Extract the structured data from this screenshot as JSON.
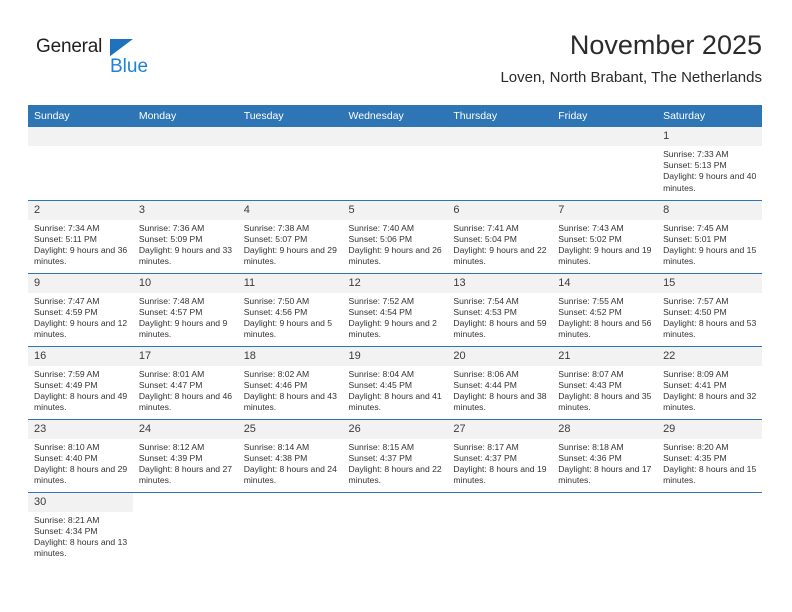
{
  "logo": {
    "word_one": "General",
    "word_two": "Blue",
    "icon": "triangle-flag-icon",
    "color_primary": "#1f73bd",
    "color_secondary": "#1f82d6"
  },
  "header": {
    "title": "November 2025",
    "subtitle": "Loven, North Brabant, The Netherlands"
  },
  "theme": {
    "header_blue": "#2e75b6",
    "daynum_gray": "#f2f2f2",
    "text": "#333333"
  },
  "calendar": {
    "weekdays": [
      "Sunday",
      "Monday",
      "Tuesday",
      "Wednesday",
      "Thursday",
      "Friday",
      "Saturday"
    ],
    "labels": {
      "sunrise": "Sunrise:",
      "sunset": "Sunset:",
      "daylight": "Daylight:"
    },
    "weeks": [
      [
        {
          "day": "",
          "empty": true
        },
        {
          "day": "",
          "empty": true
        },
        {
          "day": "",
          "empty": true
        },
        {
          "day": "",
          "empty": true
        },
        {
          "day": "",
          "empty": true
        },
        {
          "day": "",
          "empty": true
        },
        {
          "day": "1",
          "sunrise": "Sunrise: 7:33 AM",
          "sunset": "Sunset: 5:13 PM",
          "daylight": "Daylight: 9 hours and 40 minutes."
        }
      ],
      [
        {
          "day": "2",
          "sunrise": "Sunrise: 7:34 AM",
          "sunset": "Sunset: 5:11 PM",
          "daylight": "Daylight: 9 hours and 36 minutes."
        },
        {
          "day": "3",
          "sunrise": "Sunrise: 7:36 AM",
          "sunset": "Sunset: 5:09 PM",
          "daylight": "Daylight: 9 hours and 33 minutes."
        },
        {
          "day": "4",
          "sunrise": "Sunrise: 7:38 AM",
          "sunset": "Sunset: 5:07 PM",
          "daylight": "Daylight: 9 hours and 29 minutes."
        },
        {
          "day": "5",
          "sunrise": "Sunrise: 7:40 AM",
          "sunset": "Sunset: 5:06 PM",
          "daylight": "Daylight: 9 hours and 26 minutes."
        },
        {
          "day": "6",
          "sunrise": "Sunrise: 7:41 AM",
          "sunset": "Sunset: 5:04 PM",
          "daylight": "Daylight: 9 hours and 22 minutes."
        },
        {
          "day": "7",
          "sunrise": "Sunrise: 7:43 AM",
          "sunset": "Sunset: 5:02 PM",
          "daylight": "Daylight: 9 hours and 19 minutes."
        },
        {
          "day": "8",
          "sunrise": "Sunrise: 7:45 AM",
          "sunset": "Sunset: 5:01 PM",
          "daylight": "Daylight: 9 hours and 15 minutes."
        }
      ],
      [
        {
          "day": "9",
          "sunrise": "Sunrise: 7:47 AM",
          "sunset": "Sunset: 4:59 PM",
          "daylight": "Daylight: 9 hours and 12 minutes."
        },
        {
          "day": "10",
          "sunrise": "Sunrise: 7:48 AM",
          "sunset": "Sunset: 4:57 PM",
          "daylight": "Daylight: 9 hours and 9 minutes."
        },
        {
          "day": "11",
          "sunrise": "Sunrise: 7:50 AM",
          "sunset": "Sunset: 4:56 PM",
          "daylight": "Daylight: 9 hours and 5 minutes."
        },
        {
          "day": "12",
          "sunrise": "Sunrise: 7:52 AM",
          "sunset": "Sunset: 4:54 PM",
          "daylight": "Daylight: 9 hours and 2 minutes."
        },
        {
          "day": "13",
          "sunrise": "Sunrise: 7:54 AM",
          "sunset": "Sunset: 4:53 PM",
          "daylight": "Daylight: 8 hours and 59 minutes."
        },
        {
          "day": "14",
          "sunrise": "Sunrise: 7:55 AM",
          "sunset": "Sunset: 4:52 PM",
          "daylight": "Daylight: 8 hours and 56 minutes."
        },
        {
          "day": "15",
          "sunrise": "Sunrise: 7:57 AM",
          "sunset": "Sunset: 4:50 PM",
          "daylight": "Daylight: 8 hours and 53 minutes."
        }
      ],
      [
        {
          "day": "16",
          "sunrise": "Sunrise: 7:59 AM",
          "sunset": "Sunset: 4:49 PM",
          "daylight": "Daylight: 8 hours and 49 minutes."
        },
        {
          "day": "17",
          "sunrise": "Sunrise: 8:01 AM",
          "sunset": "Sunset: 4:47 PM",
          "daylight": "Daylight: 8 hours and 46 minutes."
        },
        {
          "day": "18",
          "sunrise": "Sunrise: 8:02 AM",
          "sunset": "Sunset: 4:46 PM",
          "daylight": "Daylight: 8 hours and 43 minutes."
        },
        {
          "day": "19",
          "sunrise": "Sunrise: 8:04 AM",
          "sunset": "Sunset: 4:45 PM",
          "daylight": "Daylight: 8 hours and 41 minutes."
        },
        {
          "day": "20",
          "sunrise": "Sunrise: 8:06 AM",
          "sunset": "Sunset: 4:44 PM",
          "daylight": "Daylight: 8 hours and 38 minutes."
        },
        {
          "day": "21",
          "sunrise": "Sunrise: 8:07 AM",
          "sunset": "Sunset: 4:43 PM",
          "daylight": "Daylight: 8 hours and 35 minutes."
        },
        {
          "day": "22",
          "sunrise": "Sunrise: 8:09 AM",
          "sunset": "Sunset: 4:41 PM",
          "daylight": "Daylight: 8 hours and 32 minutes."
        }
      ],
      [
        {
          "day": "23",
          "sunrise": "Sunrise: 8:10 AM",
          "sunset": "Sunset: 4:40 PM",
          "daylight": "Daylight: 8 hours and 29 minutes."
        },
        {
          "day": "24",
          "sunrise": "Sunrise: 8:12 AM",
          "sunset": "Sunset: 4:39 PM",
          "daylight": "Daylight: 8 hours and 27 minutes."
        },
        {
          "day": "25",
          "sunrise": "Sunrise: 8:14 AM",
          "sunset": "Sunset: 4:38 PM",
          "daylight": "Daylight: 8 hours and 24 minutes."
        },
        {
          "day": "26",
          "sunrise": "Sunrise: 8:15 AM",
          "sunset": "Sunset: 4:37 PM",
          "daylight": "Daylight: 8 hours and 22 minutes."
        },
        {
          "day": "27",
          "sunrise": "Sunrise: 8:17 AM",
          "sunset": "Sunset: 4:37 PM",
          "daylight": "Daylight: 8 hours and 19 minutes."
        },
        {
          "day": "28",
          "sunrise": "Sunrise: 8:18 AM",
          "sunset": "Sunset: 4:36 PM",
          "daylight": "Daylight: 8 hours and 17 minutes."
        },
        {
          "day": "29",
          "sunrise": "Sunrise: 8:20 AM",
          "sunset": "Sunset: 4:35 PM",
          "daylight": "Daylight: 8 hours and 15 minutes."
        }
      ],
      [
        {
          "day": "30",
          "sunrise": "Sunrise: 8:21 AM",
          "sunset": "Sunset: 4:34 PM",
          "daylight": "Daylight: 8 hours and 13 minutes."
        },
        {
          "day": "",
          "blank": true
        },
        {
          "day": "",
          "blank": true
        },
        {
          "day": "",
          "blank": true
        },
        {
          "day": "",
          "blank": true
        },
        {
          "day": "",
          "blank": true
        },
        {
          "day": "",
          "blank": true
        }
      ]
    ]
  }
}
